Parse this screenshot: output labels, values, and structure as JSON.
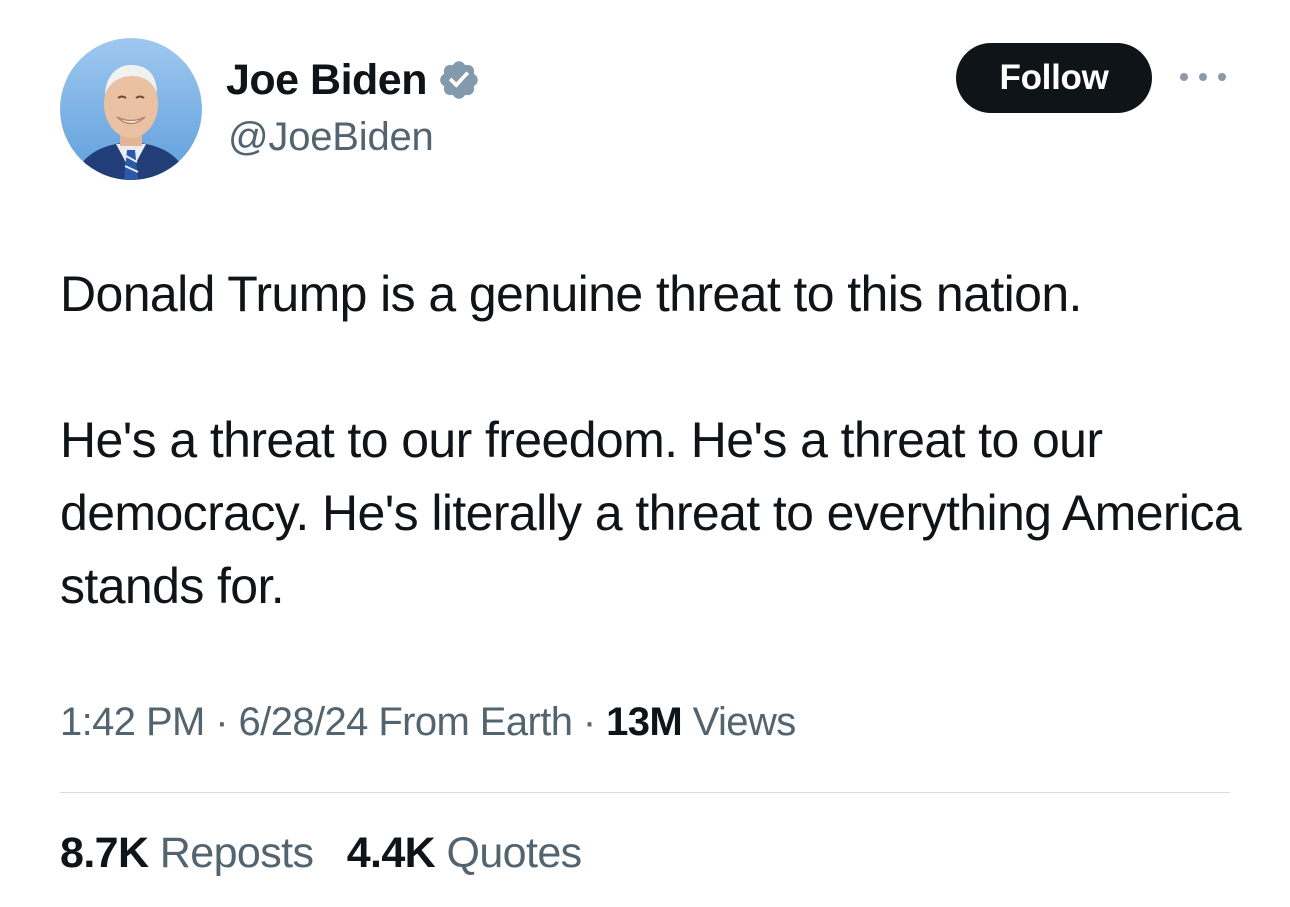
{
  "author": {
    "display_name": "Joe Biden",
    "handle": "@JoeBiden",
    "verified_icon": "verified-badge-icon",
    "avatar_icon": "profile-photo"
  },
  "actions": {
    "follow_label": "Follow",
    "more_icon": "more-options-icon"
  },
  "tweet": {
    "paragraphs": [
      "Donald Trump is a genuine threat to this nation.",
      "He's a threat to our freedom. He's a threat to our democracy. He's literally a threat to everything America stands for."
    ]
  },
  "meta": {
    "time": "1:42 PM",
    "separator": "·",
    "date": "6/28/24",
    "source": "From Earth",
    "views_count": "13M",
    "views_label": "Views"
  },
  "stats": {
    "reposts_count": "8.7K",
    "reposts_label": "Reposts",
    "quotes_count": "4.4K",
    "quotes_label": "Quotes"
  },
  "colors": {
    "primary_text": "#0f1419",
    "secondary_text": "#536471",
    "verified_badge": "#829aab",
    "follow_bg": "#0f1419",
    "divider": "#d6dbe0"
  }
}
